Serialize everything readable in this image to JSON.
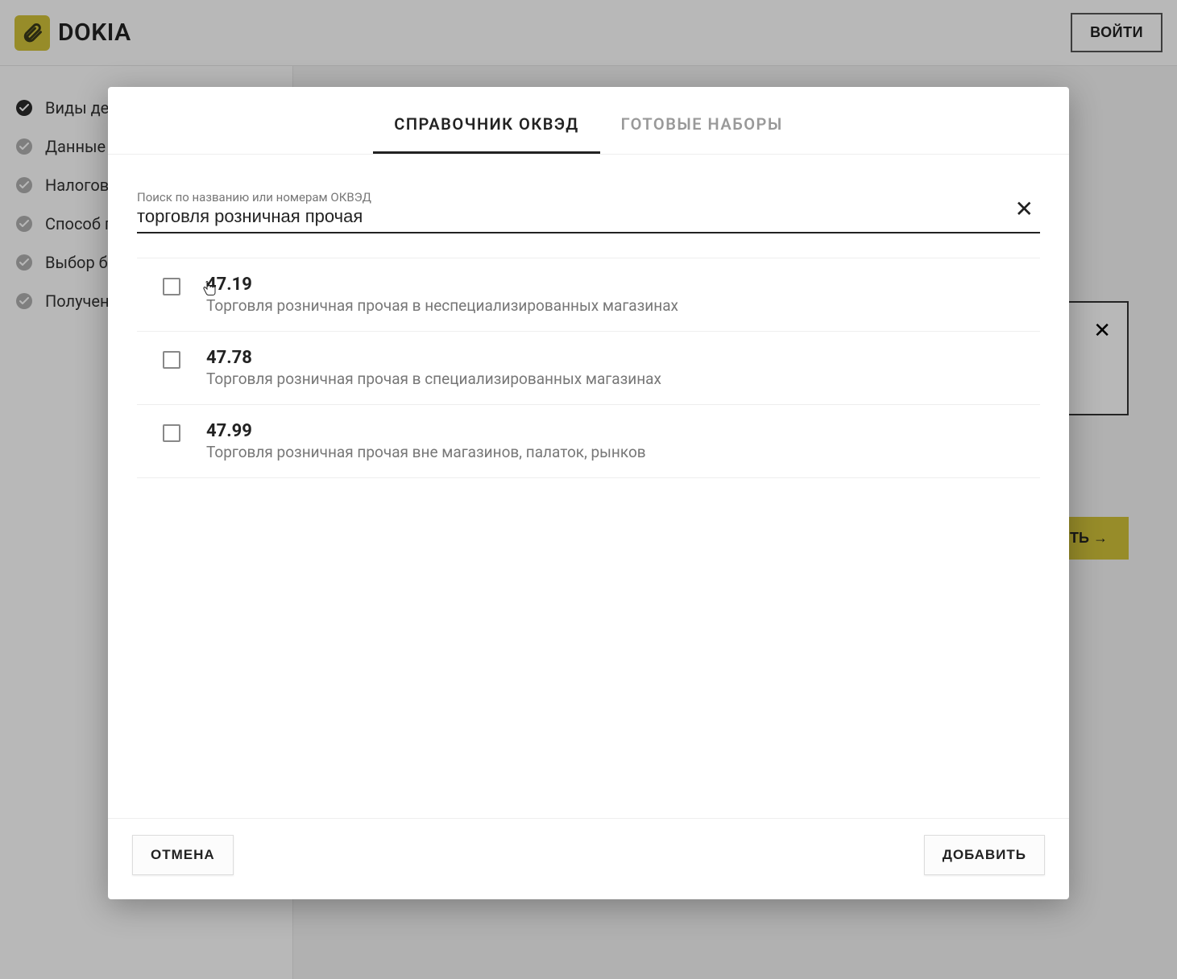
{
  "header": {
    "brand": "DOKIA",
    "login": "ВОЙТИ"
  },
  "sidebar": {
    "items": [
      {
        "label": "Виды деятельности",
        "done": true
      },
      {
        "label": "Данные ИП",
        "done": false
      },
      {
        "label": "Налоговый режим",
        "done": false
      },
      {
        "label": "Способ подачи",
        "done": false
      },
      {
        "label": "Выбор банка",
        "done": false
      },
      {
        "label": "Получение документов",
        "done": false
      }
    ]
  },
  "main": {
    "continue": "ПРОДОЛЖИТЬ →"
  },
  "modal": {
    "tabs": {
      "t1": "СПРАВОЧНИК ОКВЭД",
      "t2": "ГОТОВЫЕ НАБОРЫ"
    },
    "search": {
      "label": "Поиск по названию или номерам ОКВЭД",
      "value": "торговля розничная прочая"
    },
    "results": [
      {
        "code": "47.19",
        "desc": "Торговля розничная прочая в неспециализированных магазинах"
      },
      {
        "code": "47.78",
        "desc": "Торговля розничная прочая в специализированных магазинах"
      },
      {
        "code": "47.99",
        "desc": "Торговля розничная прочая вне магазинов, палаток, рынков"
      }
    ],
    "footer": {
      "cancel": "ОТМЕНА",
      "add": "ДОБАВИТЬ"
    }
  }
}
